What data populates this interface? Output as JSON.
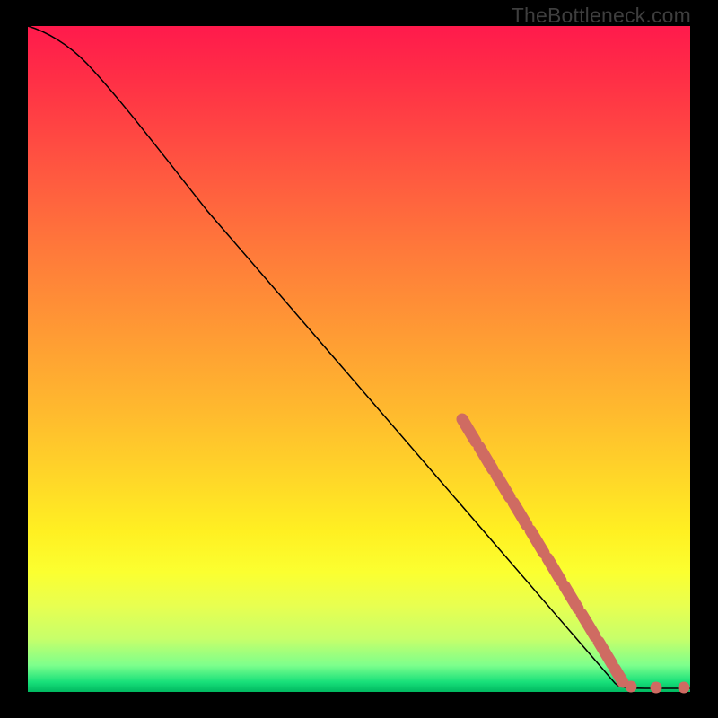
{
  "watermark": "TheBottleneck.com",
  "chart_data": {
    "type": "line",
    "title": "",
    "xlabel": "",
    "ylabel": "",
    "xlim": [
      0,
      100
    ],
    "ylim": [
      0,
      100
    ],
    "background_gradient": {
      "top": "#ff1a4c",
      "mid_high": "#ff9a34",
      "mid": "#fff022",
      "mid_low": "#c7ff6a",
      "bottom": "#00b860"
    },
    "series": [
      {
        "name": "curve",
        "style": "solid-black",
        "x": [
          0,
          2,
          5,
          8,
          12,
          18,
          26,
          34,
          42,
          50,
          58,
          66,
          74,
          82,
          88,
          90,
          92,
          94,
          96,
          98,
          100
        ],
        "y": [
          100,
          99,
          97.5,
          95,
          91,
          84,
          74,
          64,
          54,
          44,
          34,
          24,
          14,
          4,
          1.2,
          0.8,
          0.6,
          0.6,
          0.6,
          0.6,
          0.6
        ]
      },
      {
        "name": "highlighted-segment",
        "style": "thick-dotted-salmon",
        "x": [
          66,
          68,
          70,
          72,
          74,
          76,
          78,
          80,
          82,
          84,
          86,
          88,
          90.5,
          93.5,
          97,
          100
        ],
        "y": [
          41,
          38.5,
          36,
          33.5,
          31,
          28.5,
          26,
          23.5,
          21,
          17,
          13,
          9,
          5,
          1.2,
          0.8,
          0.8
        ]
      }
    ],
    "colors": {
      "curve_stroke": "#000000",
      "marker_fill": "#cf6b62"
    }
  }
}
